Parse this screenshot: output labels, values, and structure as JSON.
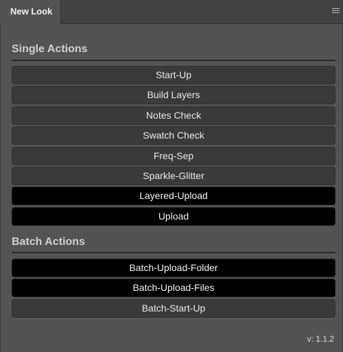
{
  "tab": {
    "title": "New Look"
  },
  "single": {
    "title": "Single Actions",
    "buttons": [
      {
        "label": "Start-Up",
        "style": "normal"
      },
      {
        "label": "Build Layers",
        "style": "normal"
      },
      {
        "label": "Notes Check",
        "style": "normal"
      },
      {
        "label": "Swatch Check",
        "style": "normal"
      },
      {
        "label": "Freq-Sep",
        "style": "normal"
      },
      {
        "label": "Sparkle-Glitter",
        "style": "normal"
      },
      {
        "label": "Layered-Upload",
        "style": "dark"
      },
      {
        "label": "Upload",
        "style": "dark"
      }
    ]
  },
  "batch": {
    "title": "Batch Actions",
    "buttons": [
      {
        "label": "Batch-Upload-Folder",
        "style": "dark"
      },
      {
        "label": "Batch-Upload-Files",
        "style": "dark"
      },
      {
        "label": "Batch-Start-Up",
        "style": "normal"
      }
    ]
  },
  "version": "v: 1.1.2",
  "icons": {
    "panel_menu": "hamburger-menu-icon"
  },
  "colors": {
    "panel_bg": "#535353",
    "button_bg": "#3a3a3a",
    "button_dark_bg": "#000000",
    "text": "#e8e8e8"
  }
}
